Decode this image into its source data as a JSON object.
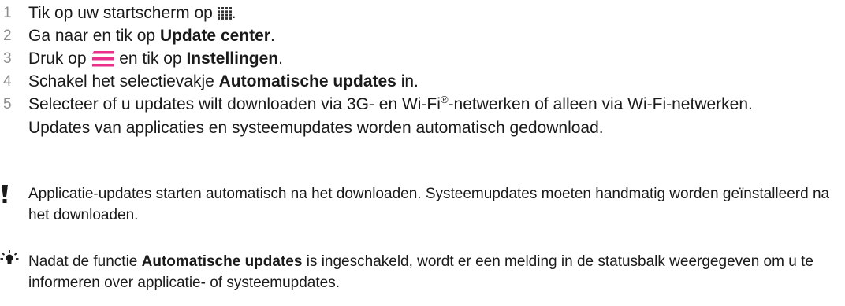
{
  "steps": [
    {
      "num": "1",
      "before": "Tik op uw startscherm op ",
      "bold": "",
      "after": ".",
      "icon": "apps-grid-icon"
    },
    {
      "num": "2",
      "before": "Ga naar en tik op ",
      "bold": "Update center",
      "after": "."
    },
    {
      "num": "3",
      "before": "Druk op ",
      "bold": "Instellingen",
      "mid": " en tik op ",
      "after": ".",
      "icon": "menu-icon"
    },
    {
      "num": "4",
      "before": "Schakel het selectievakje ",
      "bold": "Automatische updates",
      "after": " in."
    },
    {
      "num": "5",
      "before": "Selecteer of u updates wilt downloaden via 3G- en Wi-Fi",
      "sup": "®",
      "after": "-netwerken of alleen via Wi-Fi-netwerken. Updates van applicaties en systeemupdates worden automatisch gedownload."
    }
  ],
  "note_warning": {
    "icon": "exclamation-icon",
    "text": "Applicatie-updates starten automatisch na het downloaden. Systeemupdates moeten handmatig worden geïnstalleerd na het downloaden."
  },
  "note_tip": {
    "icon": "lightbulb-icon",
    "before": "Nadat de functie ",
    "bold": "Automatische updates",
    "after": " is ingeschakeld, wordt er een melding in de statusbalk weergegeven om u te informeren over applicatie- of systeemupdates."
  },
  "colors": {
    "menu_icon": "#e8308c",
    "step_number": "#8c8c8c",
    "text": "#1a1a1a"
  }
}
